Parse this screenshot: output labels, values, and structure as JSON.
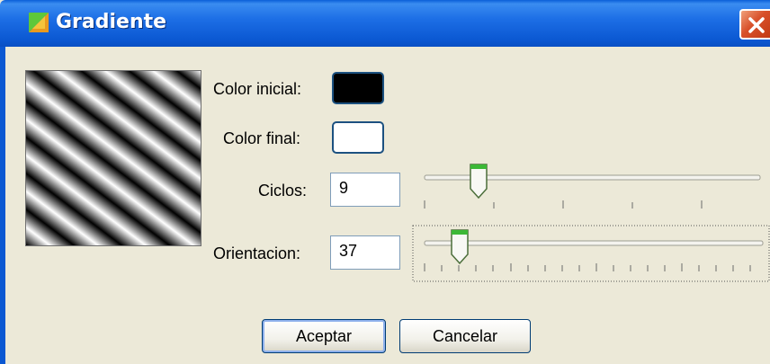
{
  "window": {
    "title": "Gradiente"
  },
  "form": {
    "color_inicial_label": "Color inicial:",
    "color_final_label": "Color final:",
    "ciclos_label": "Ciclos:",
    "orientacion_label": "Orientacion:",
    "color_inicial_value": "#000000",
    "color_final_value": "#ffffff",
    "ciclos_value": "9",
    "orientacion_value": "37"
  },
  "buttons": {
    "aceptar": "Aceptar",
    "cancelar": "Cancelar"
  },
  "icons": {
    "app": "gradient-app-icon",
    "close": "close-icon"
  },
  "colors": {
    "accent": "#0b58d2",
    "close": "#d8502a",
    "background": "#ece9d8"
  }
}
